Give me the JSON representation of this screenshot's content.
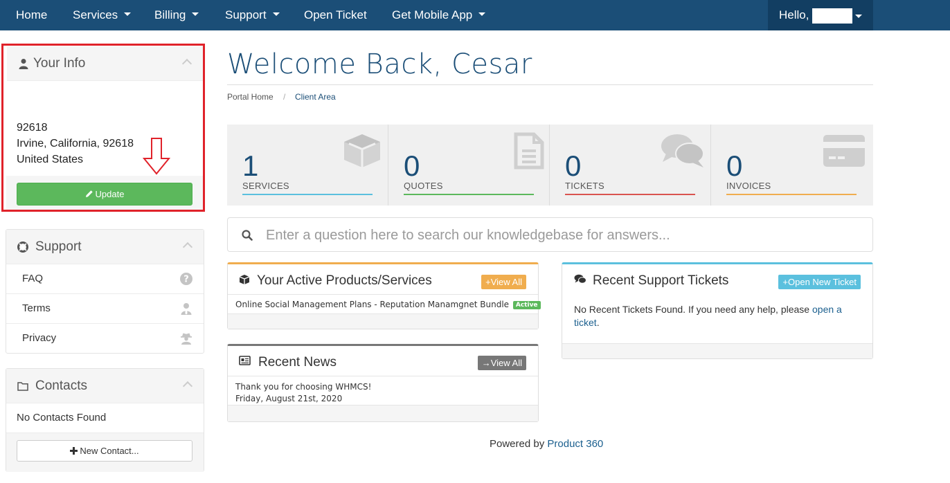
{
  "nav": {
    "items": [
      {
        "label": "Home"
      },
      {
        "label": "Services"
      },
      {
        "label": "Billing"
      },
      {
        "label": "Support"
      },
      {
        "label": "Open Ticket"
      },
      {
        "label": "Get Mobile App"
      }
    ],
    "hello_label": "Hello,"
  },
  "sidebar": {
    "your_info": {
      "title": "Your Info",
      "address_lines": [
        "92618",
        "Irvine, California, 92618",
        "United States"
      ],
      "update_label": "Update"
    },
    "support": {
      "title": "Support",
      "items": [
        {
          "label": "FAQ",
          "icon": "question-circle-icon"
        },
        {
          "label": "Terms",
          "icon": "user-tie-icon"
        },
        {
          "label": "Privacy",
          "icon": "user-secret-icon"
        }
      ]
    },
    "contacts": {
      "title": "Contacts",
      "empty_text": "No Contacts Found",
      "new_contact_label": "New Contact..."
    }
  },
  "main": {
    "welcome": "Welcome Back, Cesar",
    "breadcrumb": {
      "home": "Portal Home",
      "separator": "/",
      "current": "Client Area"
    },
    "tiles": [
      {
        "count": "1",
        "label": "SERVICES",
        "color": "#5bc0de",
        "icon": "cube-icon"
      },
      {
        "count": "0",
        "label": "QUOTES",
        "color": "#5cb85c",
        "icon": "file-text-icon"
      },
      {
        "count": "0",
        "label": "TICKETS",
        "color": "#d9534f",
        "icon": "comments-icon"
      },
      {
        "count": "0",
        "label": "INVOICES",
        "color": "#f0ad4e",
        "icon": "credit-card-icon"
      }
    ],
    "search_placeholder": "Enter a question here to search our knowledgebase for answers...",
    "products": {
      "title": "Your Active Products/Services",
      "view_all": "View All",
      "item_name": "Online Social Management Plans - Reputation Manamgnet Bundle",
      "item_status": "Active"
    },
    "news": {
      "title": "Recent News",
      "view_all": "View All",
      "headline": "Thank you for choosing WHMCS!",
      "date": "Friday, August 21st, 2020"
    },
    "tickets": {
      "title": "Recent Support Tickets",
      "open_new": "Open New Ticket",
      "empty_text": "No Recent Tickets Found. If you need any help, please",
      "open_link_1": "open a",
      "open_link_2": "ticket",
      "period": "."
    },
    "footer": {
      "powered_by": "Powered by",
      "brand": "Product 360"
    }
  },
  "colors": {
    "navy": "#1b4e77",
    "green": "#5cb85c",
    "orange": "#f0ad4e",
    "gray": "#777777",
    "info": "#5bc0de",
    "red_highlight": "#e0222a"
  }
}
